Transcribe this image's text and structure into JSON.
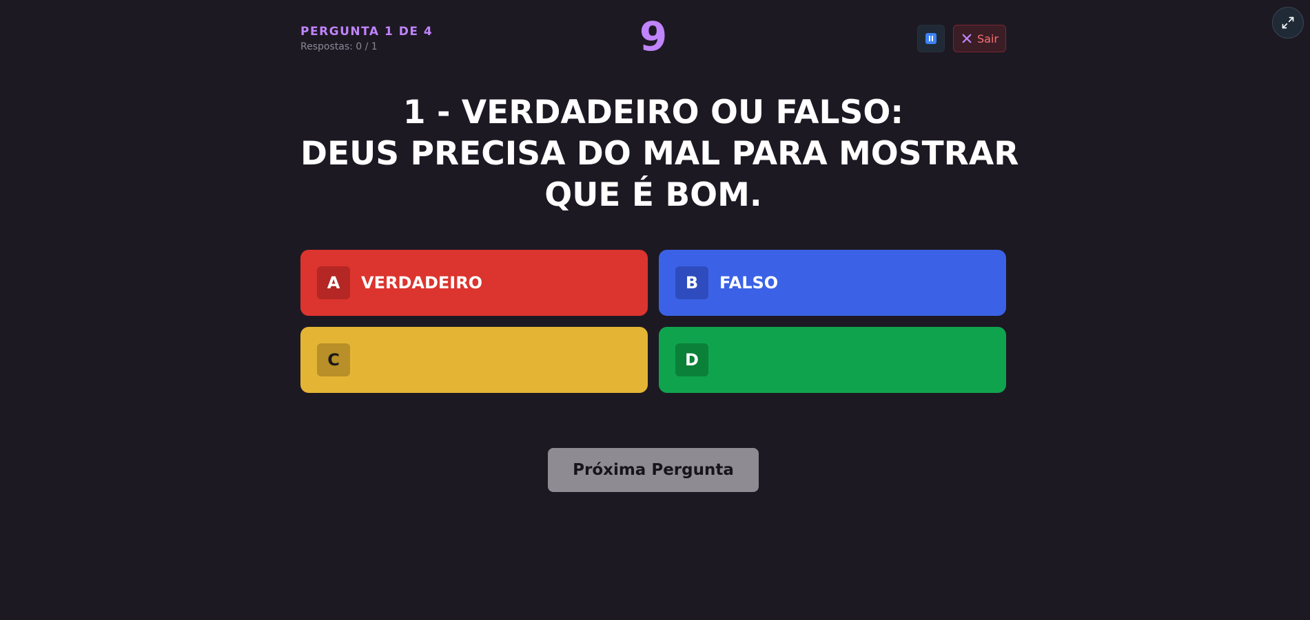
{
  "header": {
    "question_counter": "PERGUNTA 1 DE 4",
    "answers_count": "Respostas: 0 / 1",
    "timer": "9",
    "exit_label": "Sair"
  },
  "question": {
    "lines": [
      "1 - VERDADEIRO OU FALSO:",
      "DEUS PRECISA DO MAL PARA MOSTRAR",
      "QUE É BOM."
    ]
  },
  "options": [
    {
      "letter": "A",
      "text": "VERDADEIRO",
      "color": "#dc342e"
    },
    {
      "letter": "B",
      "text": "FALSO",
      "color": "#3b62e6"
    },
    {
      "letter": "C",
      "text": "",
      "color": "#e4b434"
    },
    {
      "letter": "D",
      "text": "",
      "color": "#10a34e"
    }
  ],
  "next_button": {
    "label": "Próxima Pergunta"
  },
  "icons": {
    "fullscreen": "expand-icon",
    "pause": "pause-icon",
    "exit": "close-icon"
  },
  "colors": {
    "background": "#1d1923",
    "accent": "#c084fc",
    "exit": "#f87171"
  }
}
